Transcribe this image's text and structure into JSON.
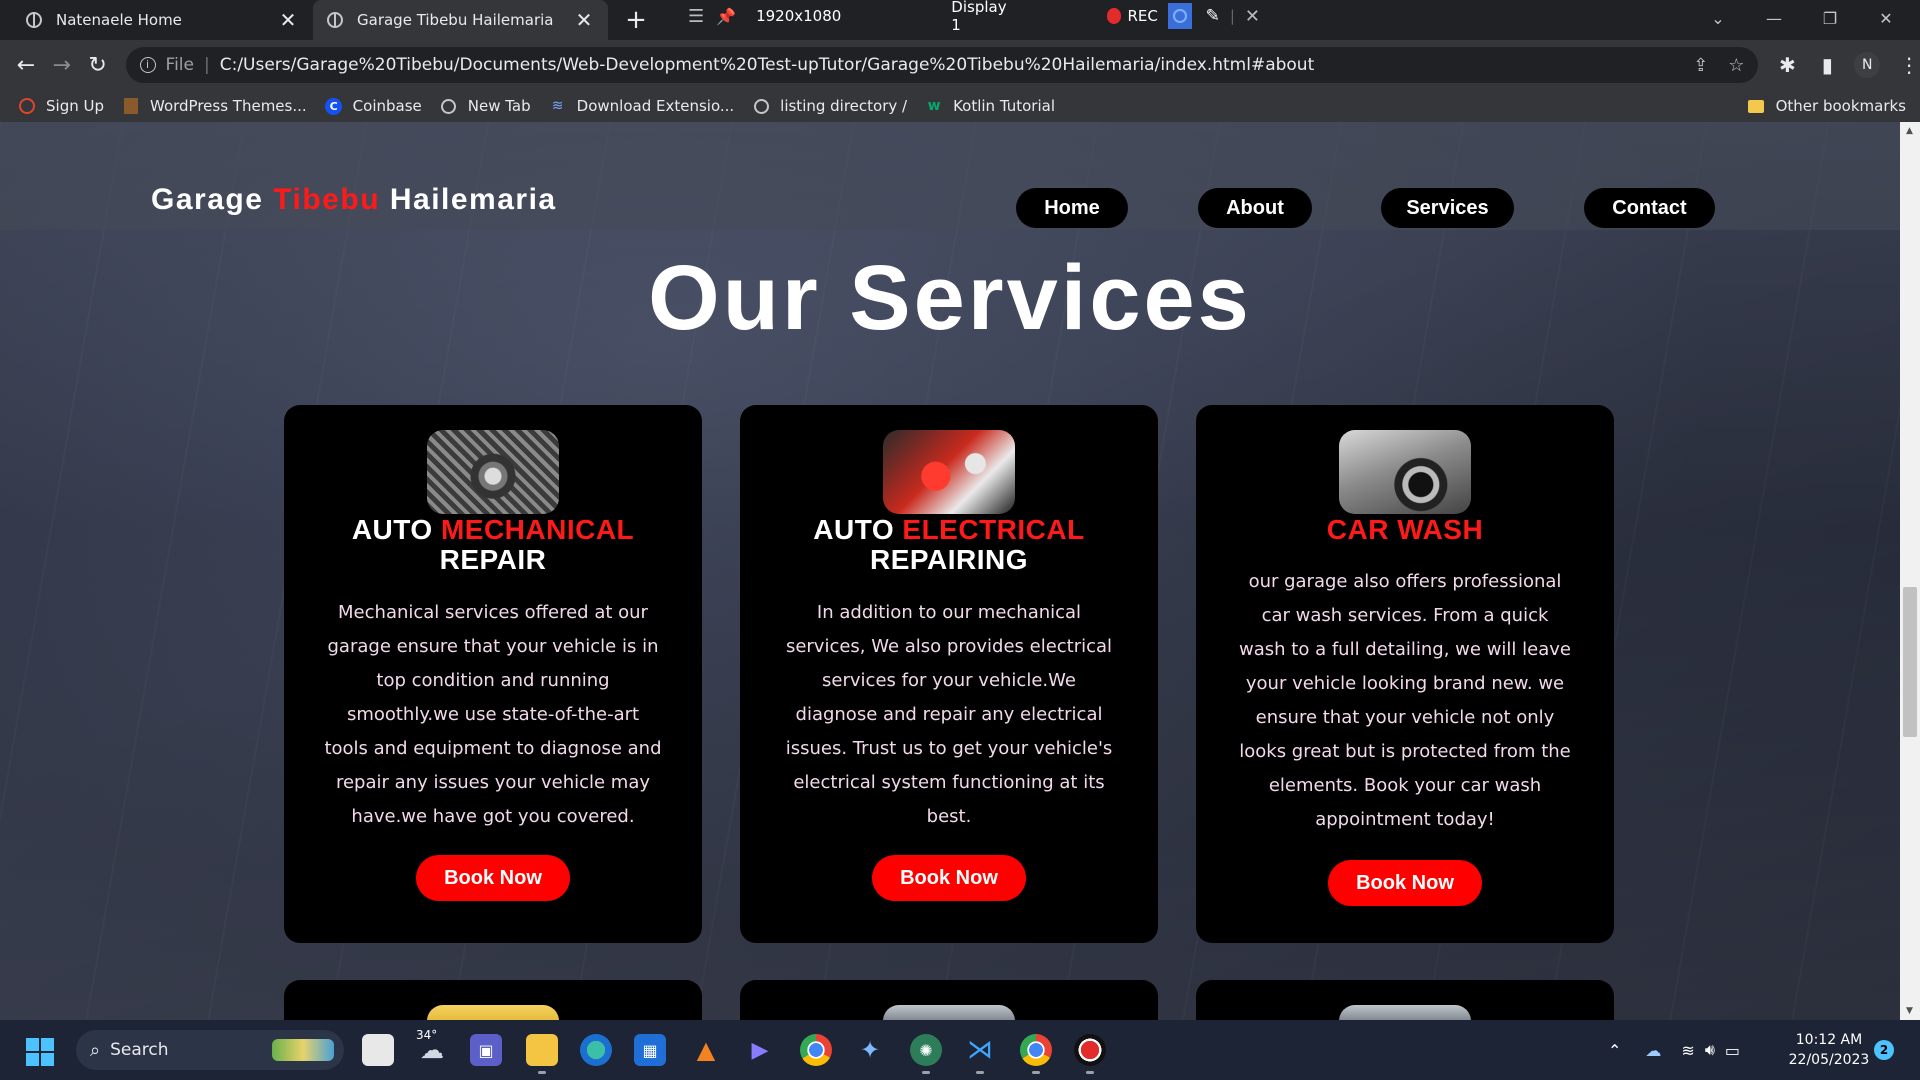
{
  "browser": {
    "tabs": [
      {
        "title": "Natenaele Home",
        "close": "✕"
      },
      {
        "title": "Garage Tibebu Hailemaria",
        "close": "✕"
      }
    ],
    "new_tab": "+",
    "recorder": {
      "resolution": "1920x1080",
      "display": "Display 1",
      "rec_label": "REC"
    },
    "omnibox": {
      "scheme": "File",
      "url": "C:/Users/Garage%20Tibebu/Documents/Web-Development%20Test-upTutor/Garage%20Tibebu%20Hailemaria/index.html#about"
    },
    "profile_initial": "N",
    "bookmarks": [
      {
        "label": "Sign Up"
      },
      {
        "label": "WordPress Themes..."
      },
      {
        "label": "Coinbase"
      },
      {
        "label": "New Tab"
      },
      {
        "label": "Download Extensio..."
      },
      {
        "label": "listing directory /"
      },
      {
        "label": "Kotlin Tutorial"
      }
    ],
    "other_bookmarks": "Other bookmarks"
  },
  "site": {
    "brand": {
      "part1": "Garage ",
      "part2": "Tibebu",
      "part3": " Hailemaria"
    },
    "nav": [
      {
        "label": "Home"
      },
      {
        "label": "About"
      },
      {
        "label": "Services"
      },
      {
        "label": "Contact"
      }
    ],
    "section_title": "Our Services",
    "services": [
      {
        "title_white": "AUTO ",
        "title_red": "MECHANICAL",
        "title_line2": "REPAIR",
        "description": "Mechanical services offered at our garage ensure that your vehicle is in top condition and running smoothly.we use state-of-the-art tools and equipment to diagnose and repair any issues your vehicle may have.we have got you covered.",
        "button": "Book Now"
      },
      {
        "title_white": "AUTO ",
        "title_red": "ELECTRICAL",
        "title_line2": "REPAIRING",
        "description": "In addition to our mechanical services, We also provides electrical services for your vehicle.We diagnose and repair any electrical issues. Trust us to get your vehicle's electrical system functioning at its best.",
        "button": "Book Now"
      },
      {
        "title_white": "",
        "title_red": "CAR WASH",
        "title_line2": "",
        "description": "our garage also offers professional car wash services. From a quick wash to a full detailing, we will leave your vehicle looking brand new. we ensure that your vehicle not only looks great but is protected from the elements. Book your car wash appointment today!",
        "button": "Book Now"
      }
    ]
  },
  "taskbar": {
    "search_label": "Search",
    "weather_temp": "34°",
    "time": "10:12 AM",
    "date": "22/05/2023",
    "notification_count": "2"
  },
  "colors": {
    "accent_red": "#ff1a1a",
    "button_red": "#ff0000",
    "card_bg": "#000000",
    "card_text": "#f1d9ea"
  }
}
